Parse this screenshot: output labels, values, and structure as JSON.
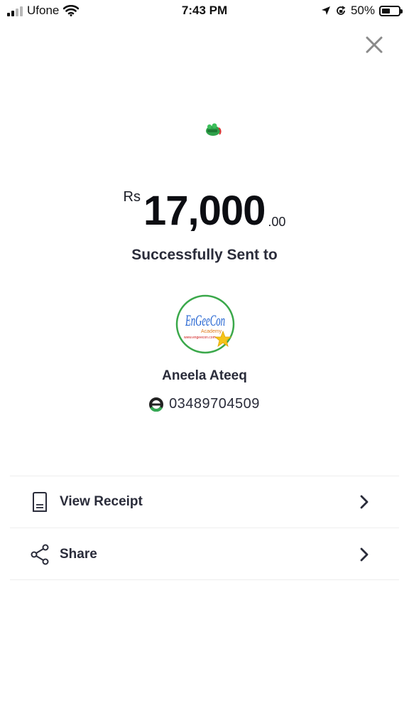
{
  "status_bar": {
    "carrier": "Ufone",
    "time": "7:43 PM",
    "battery": "50%",
    "battery_level": 0.5
  },
  "transaction": {
    "currency": "Rs",
    "amount_whole": "17,000",
    "amount_cents": ".00",
    "status_text": "Successfully Sent to"
  },
  "avatar_logo": {
    "main": "EnGeeCon",
    "sub": "Academy",
    "url": "www.engeecon.com"
  },
  "recipient": {
    "name": "Aneela Ateeq",
    "phone": "03489704509"
  },
  "actions": [
    {
      "label": "View Receipt",
      "icon": "receipt-icon"
    },
    {
      "label": "Share",
      "icon": "share-icon"
    }
  ],
  "colors": {
    "accent_green": "#34a853",
    "text_dark": "#2a2c3a",
    "close_gray": "#8a8a8a"
  }
}
